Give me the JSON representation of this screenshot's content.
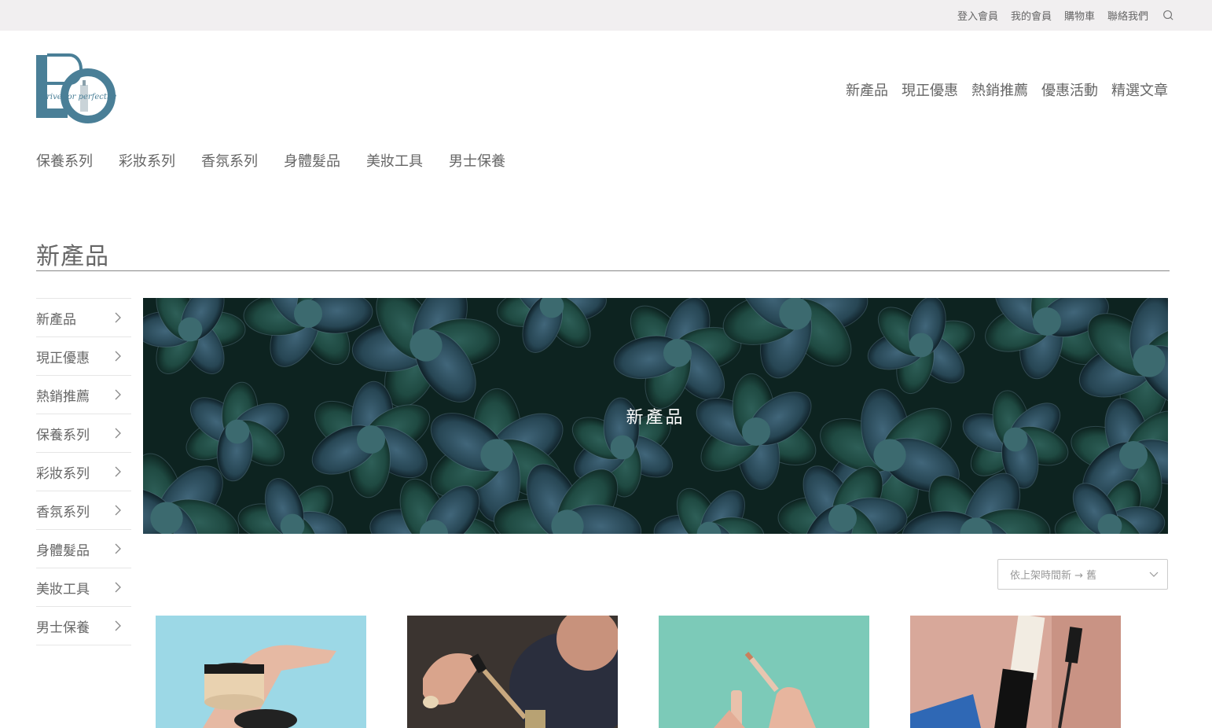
{
  "topbar": {
    "links": [
      "登入會員",
      "我的會員",
      "購物車",
      "聯絡我們"
    ],
    "search_icon": "search-icon"
  },
  "logo": {
    "tagline": "strive for perfection",
    "icon": "brand-logo"
  },
  "main_nav": [
    "新產品",
    "現正優惠",
    "熱銷推薦",
    "優惠活動",
    "精選文章"
  ],
  "category_nav": [
    "保養系列",
    "彩妝系列",
    "香氛系列",
    "身體髮品",
    "美妝工具",
    "男士保養"
  ],
  "page": {
    "title": "新產品",
    "banner_title": "新產品"
  },
  "sidebar": {
    "items": [
      "新產品",
      "現正優惠",
      "熱銷推薦",
      "保養系列",
      "彩妝系列",
      "香氛系列",
      "身體髮品",
      "美妝工具",
      "男士保養"
    ],
    "chevron_icon": "chevron-right-icon"
  },
  "sort": {
    "selected": "依上架時間新 → 舊",
    "icon": "chevron-down-icon"
  },
  "products": [
    {
      "image": "foundation-jar-photo",
      "bg": "#9cd8e6"
    },
    {
      "image": "serum-dropper-photo",
      "bg": "#3b3430"
    },
    {
      "image": "concealer-wand-photo",
      "bg": "#7ccab8"
    },
    {
      "image": "mascara-photo",
      "bg": "#d8a89a"
    }
  ],
  "colors": {
    "topbar_bg": "#f1eff0",
    "logo_blue": "#4a7f97",
    "text": "#666666",
    "banner_leaf": "#1f4a42"
  }
}
